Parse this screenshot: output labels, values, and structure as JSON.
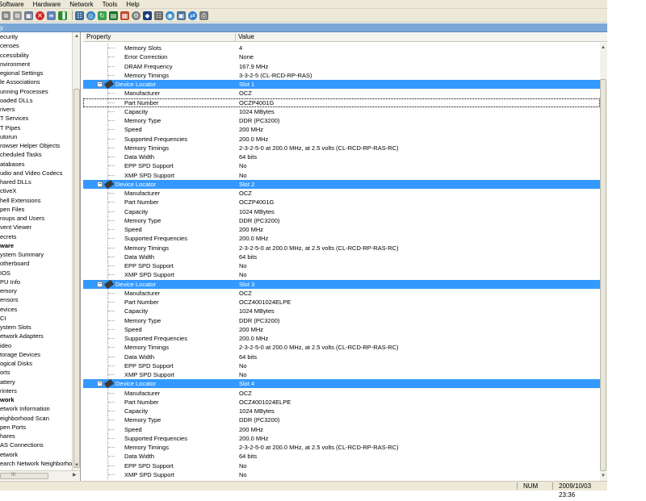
{
  "menu": [
    "Software",
    "Hardware",
    "Network",
    "Tools",
    "Help"
  ],
  "toolbar_icons": [
    "copy-icon",
    "copy-all-icon",
    "save-icon",
    "stop-icon",
    "report-icon",
    "chart-icon",
    "network-icon",
    "globe-icon",
    "refresh-icon",
    "ram-icon",
    "calculator-icon",
    "settings-icon",
    "shield-icon",
    "network-scan-icon",
    "world-icon",
    "lock-icon",
    "sync-icon",
    "printer-icon"
  ],
  "bluebar_title": "y",
  "tree": {
    "items": [
      {
        "label": "ecurity",
        "bold": false
      },
      {
        "label": "censes",
        "bold": false
      },
      {
        "label": "ccessibility",
        "bold": false
      },
      {
        "label": "nvironment",
        "bold": false
      },
      {
        "label": "egional Settings",
        "bold": false
      },
      {
        "label": "le Associations",
        "bold": false
      },
      {
        "label": "unning Processes",
        "bold": false
      },
      {
        "label": "oaded DLLs",
        "bold": false
      },
      {
        "label": "rivers",
        "bold": false
      },
      {
        "label": "T Services",
        "bold": false
      },
      {
        "label": "T Pipes",
        "bold": false
      },
      {
        "label": "utorun",
        "bold": false
      },
      {
        "label": "rowser Helper Objects",
        "bold": false
      },
      {
        "label": "cheduled Tasks",
        "bold": false
      },
      {
        "label": "atabases",
        "bold": false
      },
      {
        "label": "udio and Video Codecs",
        "bold": false
      },
      {
        "label": "hared DLLs",
        "bold": false
      },
      {
        "label": "ctiveX",
        "bold": false
      },
      {
        "label": "hell Extensions",
        "bold": false
      },
      {
        "label": "pen Files",
        "bold": false
      },
      {
        "label": "roups and Users",
        "bold": false
      },
      {
        "label": "vent Viewer",
        "bold": false
      },
      {
        "label": "ecrets",
        "bold": false
      },
      {
        "label": "ware",
        "bold": true
      },
      {
        "label": "ystem Summary",
        "bold": false
      },
      {
        "label": "otherboard",
        "bold": false
      },
      {
        "label": "IOS",
        "bold": false
      },
      {
        "label": "PU Info",
        "bold": false
      },
      {
        "label": "emory",
        "bold": false
      },
      {
        "label": "ensors",
        "bold": false
      },
      {
        "label": "evices",
        "bold": false
      },
      {
        "label": "CI",
        "bold": false
      },
      {
        "label": "ystem Slots",
        "bold": false
      },
      {
        "label": "etwork Adapters",
        "bold": false
      },
      {
        "label": "ideo",
        "bold": false
      },
      {
        "label": "torage Devices",
        "bold": false
      },
      {
        "label": "ogical Disks",
        "bold": false
      },
      {
        "label": "orts",
        "bold": false
      },
      {
        "label": "attery",
        "bold": false
      },
      {
        "label": "rinters",
        "bold": false
      },
      {
        "label": "work",
        "bold": true
      },
      {
        "label": "etwork Information",
        "bold": false
      },
      {
        "label": "eighborhood Scan",
        "bold": false
      },
      {
        "label": "pen Ports",
        "bold": false
      },
      {
        "label": "hares",
        "bold": false
      },
      {
        "label": "AS Connections",
        "bold": false
      },
      {
        "label": "etwork",
        "bold": false
      },
      {
        "label": "earch Network Neighborho",
        "bold": false
      }
    ],
    "hscroll_label": "III"
  },
  "table": {
    "col_property": "Property",
    "col_value": "Value",
    "rows": [
      {
        "type": "item",
        "prop": "Memory Slots",
        "val": "4"
      },
      {
        "type": "item",
        "prop": "Error Correction",
        "val": "None"
      },
      {
        "type": "item",
        "prop": "DRAM Frequency",
        "val": "167.9 MHz"
      },
      {
        "type": "item",
        "prop": "Memory Timings",
        "val": "3-3-2-5 (CL-RCD-RP-RAS)"
      },
      {
        "type": "header",
        "prop": "Device Locator",
        "val": "Slot 1"
      },
      {
        "type": "item",
        "prop": "Manufacturer",
        "val": "OCZ"
      },
      {
        "type": "item",
        "prop": "Part Number",
        "val": "OCZP4001G",
        "focused": true
      },
      {
        "type": "item",
        "prop": "Capacity",
        "val": "1024 MBytes"
      },
      {
        "type": "item",
        "prop": "Memory Type",
        "val": "DDR (PC3200)"
      },
      {
        "type": "item",
        "prop": "Speed",
        "val": "200 MHz"
      },
      {
        "type": "item",
        "prop": "Supported Frequencies",
        "val": "200.0 MHz"
      },
      {
        "type": "item",
        "prop": "Memory Timings",
        "val": "2-3-2-5-0 at 200.0 MHz, at 2.5 volts (CL-RCD-RP-RAS-RC)"
      },
      {
        "type": "item",
        "prop": "Data Width",
        "val": "64 bits"
      },
      {
        "type": "item",
        "prop": "EPP SPD Support",
        "val": "No"
      },
      {
        "type": "item",
        "prop": "XMP SPD Support",
        "val": "No"
      },
      {
        "type": "header",
        "prop": "Device Locator",
        "val": "Slot 2"
      },
      {
        "type": "item",
        "prop": "Manufacturer",
        "val": "OCZ"
      },
      {
        "type": "item",
        "prop": "Part Number",
        "val": "OCZP4001G"
      },
      {
        "type": "item",
        "prop": "Capacity",
        "val": "1024 MBytes"
      },
      {
        "type": "item",
        "prop": "Memory Type",
        "val": "DDR (PC3200)"
      },
      {
        "type": "item",
        "prop": "Speed",
        "val": "200 MHz"
      },
      {
        "type": "item",
        "prop": "Supported Frequencies",
        "val": "200.0 MHz"
      },
      {
        "type": "item",
        "prop": "Memory Timings",
        "val": "2-3-2-5-0 at 200.0 MHz, at 2.5 volts (CL-RCD-RP-RAS-RC)"
      },
      {
        "type": "item",
        "prop": "Data Width",
        "val": "64 bits"
      },
      {
        "type": "item",
        "prop": "EPP SPD Support",
        "val": "No"
      },
      {
        "type": "item",
        "prop": "XMP SPD Support",
        "val": "No"
      },
      {
        "type": "header",
        "prop": "Device Locator",
        "val": "Slot 3"
      },
      {
        "type": "item",
        "prop": "Manufacturer",
        "val": "OCZ"
      },
      {
        "type": "item",
        "prop": "Part Number",
        "val": "OCZ4001024ELPE"
      },
      {
        "type": "item",
        "prop": "Capacity",
        "val": "1024 MBytes"
      },
      {
        "type": "item",
        "prop": "Memory Type",
        "val": "DDR (PC3200)"
      },
      {
        "type": "item",
        "prop": "Speed",
        "val": "200 MHz"
      },
      {
        "type": "item",
        "prop": "Supported Frequencies",
        "val": "200.0 MHz"
      },
      {
        "type": "item",
        "prop": "Memory Timings",
        "val": "2-3-2-5-0 at 200.0 MHz, at 2.5 volts (CL-RCD-RP-RAS-RC)"
      },
      {
        "type": "item",
        "prop": "Data Width",
        "val": "64 bits"
      },
      {
        "type": "item",
        "prop": "EPP SPD Support",
        "val": "No"
      },
      {
        "type": "item",
        "prop": "XMP SPD Support",
        "val": "No"
      },
      {
        "type": "header",
        "prop": "Device Locator",
        "val": "Slot 4"
      },
      {
        "type": "item",
        "prop": "Manufacturer",
        "val": "OCZ"
      },
      {
        "type": "item",
        "prop": "Part Number",
        "val": "OCZ4001024ELPE"
      },
      {
        "type": "item",
        "prop": "Capacity",
        "val": "1024 MBytes"
      },
      {
        "type": "item",
        "prop": "Memory Type",
        "val": "DDR (PC3200)"
      },
      {
        "type": "item",
        "prop": "Speed",
        "val": "200 MHz"
      },
      {
        "type": "item",
        "prop": "Supported Frequencies",
        "val": "200.0 MHz"
      },
      {
        "type": "item",
        "prop": "Memory Timings",
        "val": "2-3-2-5-0 at 200.0 MHz, at 2.5 volts (CL-RCD-RP-RAS-RC)"
      },
      {
        "type": "item",
        "prop": "Data Width",
        "val": "64 bits"
      },
      {
        "type": "item",
        "prop": "EPP SPD Support",
        "val": "No"
      },
      {
        "type": "item",
        "prop": "XMP SPD Support",
        "val": "No"
      }
    ]
  },
  "status": {
    "num": "NUM",
    "datetime": "2009/10/03 23:36"
  },
  "colors": {
    "selection": "#3399ff",
    "chrome": "#ece9d8",
    "bluebar": "#7aa7d6"
  }
}
